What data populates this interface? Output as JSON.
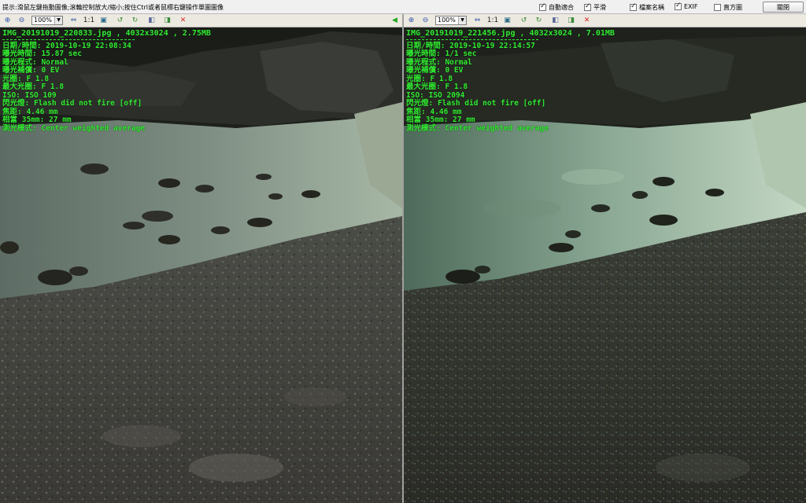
{
  "topbar": {
    "hint": "提示:滑鼠左鍵拖動圖像;滾輪控制放大/縮小;按住Ctrl或者鼠標右鍵操作單圖圖像",
    "options": [
      {
        "label": "自動適合",
        "checked": true
      },
      {
        "label": "平滑",
        "checked": true
      },
      {
        "label": "檔案名稱",
        "checked": true
      },
      {
        "label": "EXIF",
        "checked": true
      },
      {
        "label": "直方圖",
        "checked": false
      }
    ],
    "close_label": "關閉"
  },
  "left": {
    "zoom": "100%",
    "scale_label": "1:1",
    "filename_line": "IMG_20191019_220833.jpg , 4032x3024 , 2.75MB",
    "exif": [
      "日期/時間: 2019-10-19 22:08:34",
      "曝光時間: 15.87 sec",
      "曝光程式: Normal",
      "曝光補償: 0 EV",
      "光圈: F 1.8",
      "最大光圈: F 1.8",
      "ISO: ISO 109",
      "閃光燈: Flash did not fire [off]",
      "焦距: 4.46 mm",
      "相當 35mm: 27 mm",
      "測光模式: Center weighted average"
    ]
  },
  "right": {
    "zoom": "100%",
    "scale_label": "1:1",
    "filename_line": "IMG_20191019_221456.jpg , 4032x3024 , 7.01MB",
    "exif": [
      "日期/時間: 2019-10-19 22:14:57",
      "曝光時間: 1/1 sec",
      "曝光程式: Normal",
      "曝光補償: 0 EV",
      "光圈: F 1.8",
      "最大光圈: F 1.8",
      "ISO: ISO 2094",
      "閃光燈: Flash did not fire [off]",
      "焦距: 4.46 mm",
      "相當 35mm: 27 mm",
      "測光模式: Center weighted average"
    ]
  }
}
